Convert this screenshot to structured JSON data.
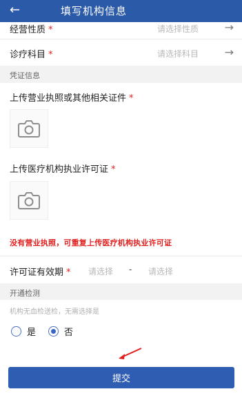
{
  "header": {
    "title": "填写机构信息",
    "back_icon": "arrow-left-icon"
  },
  "fields": {
    "nature": {
      "label": "经营性质",
      "placeholder": "请选择性质",
      "required": "*"
    },
    "department": {
      "label": "诊疗科目",
      "placeholder": "请选择科目",
      "required": "*"
    }
  },
  "credentials": {
    "section_title": "凭证信息",
    "license_upload": {
      "label": "上传营业执照或其他相关证件",
      "required": "*",
      "icon": "camera-icon"
    },
    "practice_upload": {
      "label": "上传医疗机构执业许可证",
      "required": "*",
      "icon": "camera-icon"
    },
    "warning": "没有营业执照，可重复上传医疗机构执业许可证",
    "validity": {
      "label": "许可证有效期",
      "required": "*",
      "start_placeholder": "请选择",
      "separator": "-",
      "end_placeholder": "请选择"
    }
  },
  "detection": {
    "section_title": "开通检测",
    "hint": "机构无血检送检，无需选择是",
    "options": [
      {
        "label": "是",
        "selected": false
      },
      {
        "label": "否",
        "selected": true
      }
    ]
  },
  "submit_label": "提交",
  "colors": {
    "header": "#2b5aa8",
    "required": "#e0211f",
    "submit": "#2e5db2",
    "annotation_arrow": "#e0211f"
  }
}
